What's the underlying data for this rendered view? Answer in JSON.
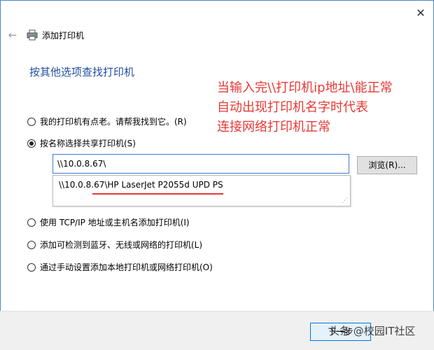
{
  "window": {
    "title": "添加打印机",
    "back_icon": "←",
    "close_icon": "✕"
  },
  "heading": "按其他选项查找打印机",
  "annotation": "当输入完\\\\打印机ip地址\\能正常\n自动出现打印机名字时代表\n连接网络打印机正常",
  "options": [
    {
      "label": "我的打印机有点老。请帮我找到它。(R)",
      "checked": false
    },
    {
      "label": "按名称选择共享打印机(S)",
      "checked": true
    },
    {
      "label": "使用 TCP/IP 地址或主机名添加打印机(I)",
      "checked": false
    },
    {
      "label": "添加可检测到蓝牙、无线或网络的打印机(L)",
      "checked": false
    },
    {
      "label": "通过手动设置添加本地打印机或网络打印机(O)",
      "checked": false
    }
  ],
  "share_input": {
    "value": "\\\\10.0.8.67\\"
  },
  "browse_label": "浏览(R)...",
  "suggestion": "\\\\10.0.8.67\\HP LaserJet P2055d UPD PS",
  "footer": {
    "next_label": "下一步",
    "watermark": "头条 @校园IT社区"
  },
  "colors": {
    "heading": "#1f4e9e",
    "annotation": "#e53935",
    "focus_border": "#3a7bd5"
  }
}
